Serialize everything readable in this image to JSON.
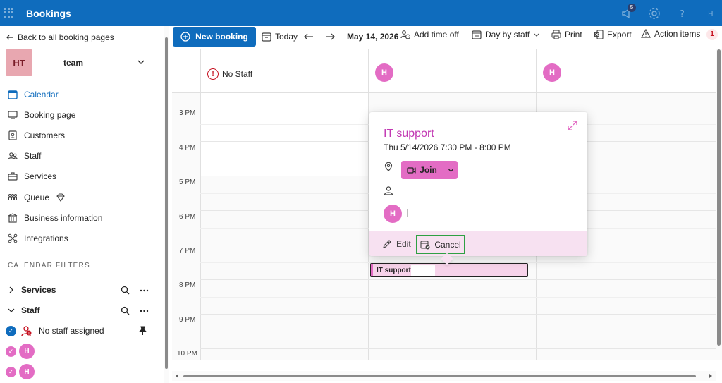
{
  "app": {
    "title": "Bookings",
    "notification_count": "5"
  },
  "sidebar": {
    "back_label": "Back to all booking pages",
    "team": {
      "initials": "HT",
      "name": "team"
    },
    "nav": [
      {
        "label": "Calendar",
        "icon": "calendar-icon",
        "active": true
      },
      {
        "label": "Booking page",
        "icon": "monitor-icon"
      },
      {
        "label": "Customers",
        "icon": "contact-card-icon"
      },
      {
        "label": "Staff",
        "icon": "people-icon"
      },
      {
        "label": "Services",
        "icon": "briefcase-icon"
      },
      {
        "label": "Queue",
        "icon": "people-queue-icon"
      },
      {
        "label": "Business information",
        "icon": "building-icon"
      },
      {
        "label": "Integrations",
        "icon": "integrations-icon"
      }
    ],
    "filters_title": "CALENDAR FILTERS",
    "filters": {
      "services_label": "Services",
      "staff_label": "Staff"
    },
    "staff": [
      {
        "label": "No staff assigned"
      },
      {
        "initial": "H"
      },
      {
        "initial": "H"
      }
    ]
  },
  "toolbar": {
    "new_booking": "New booking",
    "today": "Today",
    "date": "May 14, 2026",
    "add_time_off": "Add time off",
    "view": "Day by staff",
    "print": "Print",
    "export": "Export",
    "action_items": "Action items",
    "action_items_count": "1"
  },
  "calendar": {
    "columns": [
      {
        "label": "No Staff"
      },
      {
        "initial": "H"
      },
      {
        "initial": "H"
      }
    ],
    "times": [
      "3 PM",
      "4 PM",
      "5 PM",
      "6 PM",
      "7 PM",
      "8 PM",
      "9 PM",
      "10 PM"
    ],
    "event": {
      "title": "IT support"
    }
  },
  "popup": {
    "title": "IT support",
    "time": "Thu 5/14/2026 7:30 PM - 8:00 PM",
    "join_label": "Join",
    "attendee_initial": "H",
    "edit_label": "Edit",
    "cancel_label": "Cancel"
  },
  "colors": {
    "brand": "#0f6cbd",
    "accent_pink": "#e36cc4",
    "title_pink": "#c239b3",
    "highlight_green": "#2ea043"
  }
}
